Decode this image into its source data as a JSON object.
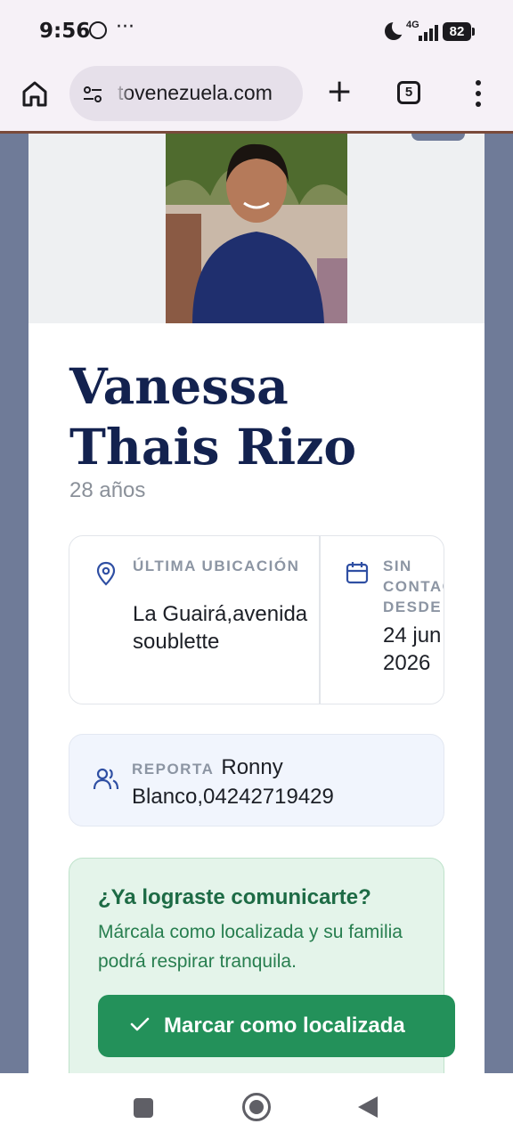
{
  "status_bar": {
    "time": "9:56",
    "more": "···",
    "network": "4G",
    "battery": "82"
  },
  "browser": {
    "url": "tovenezuela.com",
    "tab_count": "5",
    "new_tab": "+"
  },
  "profile": {
    "name": "Vanessa Thais Rizo",
    "age": "28 años"
  },
  "info": {
    "location_label": "ÚLTIMA UBICACIÓN",
    "location_value": "La Guairá,avenida soublette",
    "since_label": "SIN CONTACTO DESDE",
    "since_value": "24 jun 2026"
  },
  "report": {
    "label": "REPORTA",
    "value": "Ronny Blanco,04242719429"
  },
  "contact": {
    "title": "¿Ya lograste comunicarte?",
    "body": "Márcala como localizada y su familia podrá respirar tranquila.",
    "button_label": "Marcar como localizada"
  },
  "colors": {
    "accent_navy": "#13224f",
    "success_green": "#23915a",
    "backdrop": "#6f7b98"
  },
  "icons": {
    "location": "map-pin-icon",
    "calendar": "calendar-icon",
    "users": "users-icon",
    "check": "check-icon"
  }
}
